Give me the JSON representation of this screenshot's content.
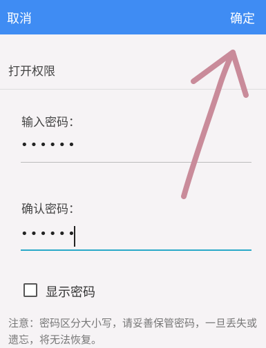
{
  "header": {
    "cancel_label": "取消",
    "confirm_label": "确定",
    "background": "#3f8cf3"
  },
  "section": {
    "title": "打开权限"
  },
  "password": {
    "label": "输入密码：",
    "value": "••••••"
  },
  "confirm_password": {
    "label": "确认密码：",
    "value": "••••••"
  },
  "show_password": {
    "label": "显示密码",
    "checked": false
  },
  "note": {
    "text": "注意：密码区分大小写，请妥善保管密码，一旦丢失或遗忘，将无法恢复。"
  },
  "annotation": {
    "arrow_color": "#c98b9a"
  },
  "colors": {
    "accent": "#28a8c8"
  }
}
